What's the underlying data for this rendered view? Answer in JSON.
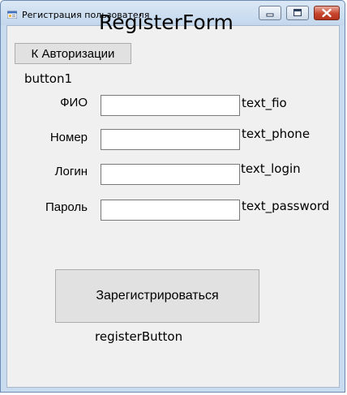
{
  "window": {
    "title": "Регистрация пользователя",
    "form_title": "RegisterForm",
    "icon": "app-form-icon",
    "minimize_icon": "minimize-icon",
    "maximize_icon": "maximize-icon",
    "close_icon": "close-icon"
  },
  "auth_button": {
    "label": "К Авторизации",
    "name": "button1"
  },
  "fields": [
    {
      "label": "ФИО",
      "value": "",
      "name": "text_fio"
    },
    {
      "label": "Номер",
      "value": "",
      "name": "text_phone"
    },
    {
      "label": "Логин",
      "value": "",
      "name": "text_login"
    },
    {
      "label": "Пароль",
      "value": "",
      "name": "text_password"
    }
  ],
  "register_button": {
    "label": "Зарегистрироваться",
    "name": "registerButton"
  },
  "colors": {
    "titlebar": "#c9dcef",
    "client": "#f0f0f0",
    "button": "#e1e1e1",
    "close_button": "#c7452d"
  }
}
